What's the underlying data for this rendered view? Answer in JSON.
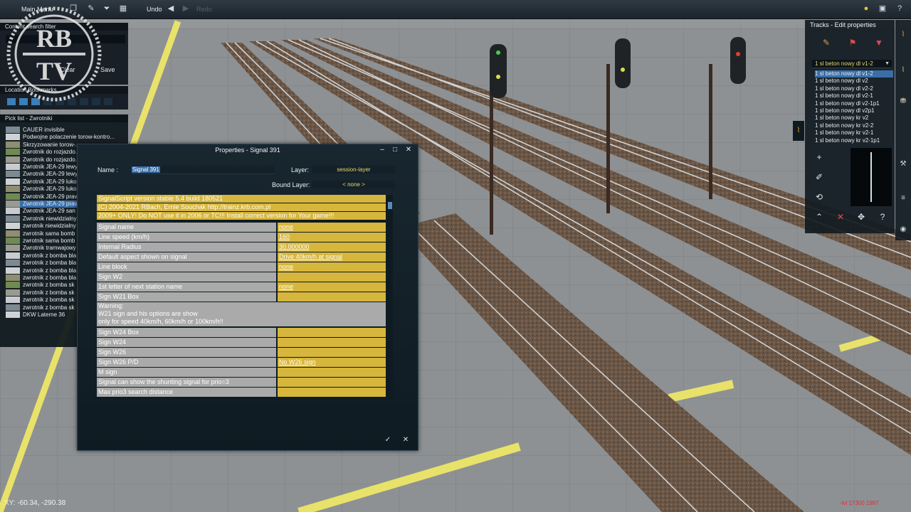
{
  "toolbar": {
    "main_menu": "Main Menu",
    "undo": "Undo",
    "redo": "Redo"
  },
  "left_panels": {
    "content_search_filter": "Content search filter",
    "clear": "Clear",
    "save": "Save",
    "location_bookmarks": "Location Bookmarks",
    "pick_list_title": "Pick list - Zwrotniki",
    "pick_items": [
      "CAUER invisible",
      "Podwojne polaczenie torow-kontro...",
      "Skrzyzowanie torow-...",
      "Zwrotnik do rozjazdo...",
      "Zwrotnik do rozjazdo...",
      "Zwrotnik JEA-29 lewy",
      "Zwrotnik JEA-29 lewy",
      "Zwrotnik JEA-29 luko",
      "Zwrotnik JEA-29 luko",
      "Zwrotnik JEA-29 prav",
      "Zwrotnik JEA-29 prav",
      "Zwrotnik JEA-29 san",
      "Zwrotnik niewidzialny",
      "zwrotnik niewidzialny",
      "zwrotnik sama bomb",
      "zwrotnik sama bomb",
      "Zwrotnik tramwajowy",
      "zwrotnik z bomba bla",
      "zwrotnik z bomba bla",
      "zwrotnik z bomba bla",
      "zwrotnik z bomba bla",
      "zwrotnik z bomba sk",
      "zwrotnik z bomba sk",
      "zwrotnik z bomba sk",
      "zwrotnik z bomba sk",
      "DKW Laterne 36"
    ],
    "selected_pick_index": 10
  },
  "logo": {
    "text_top": "RB",
    "text_bottom": "TV"
  },
  "dialog": {
    "title": "Properties - Signal 391",
    "name_label": "Name :",
    "name_value": "Signal 391",
    "layer_label": "Layer:",
    "layer_value": "session-layer",
    "bound_layer_label": "Bound Layer:",
    "bound_layer_value": "< none >",
    "header_lines": [
      "SignalScript version  stable 5.4 build 180521",
      "(C) 2004-2021 RBach, Ernie Souchak http://trainz.krb.com.pl",
      "2009+ ONLY! Do NOT use it in 2006 or TC!!! Install correct version for Your game!!!"
    ],
    "rows_a": [
      {
        "k": "Signal name",
        "v": "none"
      },
      {
        "k": "Line speed (km/h)",
        "v": "160"
      },
      {
        "k": "Internal Radius",
        "v": "30.000000"
      },
      {
        "k": "Default aspect shown on signal",
        "v": "Drive 40km/h at signal"
      },
      {
        "k": "Line block",
        "v": "none"
      },
      {
        "k": "Sign W2",
        "v": ""
      },
      {
        "k": "1st letter of next station name",
        "v": "none"
      },
      {
        "k": "Sign W21 Box",
        "v": ""
      }
    ],
    "warning_lines": [
      "Warning:",
      "W21 sign and his options are show",
      "only for speed 40km/h, 60km/h or 100km/h!!"
    ],
    "rows_b": [
      {
        "k": "Sign W24 Box",
        "v": ""
      },
      {
        "k": "Sign W24",
        "v": ""
      },
      {
        "k": "Sign W26",
        "v": ""
      },
      {
        "k": "Sign W26 P/D",
        "v": "No W26 sign"
      },
      {
        "k": "M sign",
        "v": ""
      },
      {
        "k": "Signal can show the shunting signal for prio=3",
        "v": ""
      },
      {
        "k": "Max prio3 search distance",
        "v": ""
      }
    ],
    "ok_icon": "check-icon",
    "cancel_icon": "close-icon"
  },
  "right_panel": {
    "title": "Tracks - Edit properties",
    "selected_track": "1 sl beton nowy dl v1-2",
    "track_items": [
      "1 sl beton nowy dl v1-2",
      "1 sl beton nowy dl v2",
      "1 sl beton nowy dl v2-2",
      "1 sl beton nowy dl v2-1",
      "1 sl beton nowy dl v2-1p1",
      "1 sl beton nowy dl v2p1",
      "1 sl beton nowy kr v2",
      "1 sl beton nowy kr v2-2",
      "1 sl beton nowy kr v2-1",
      "1 sl beton nowy kr v2-1p1"
    ]
  },
  "status": {
    "coords": "XY: -60.34, -290.38",
    "build": "-lvl 17300 1997"
  },
  "colors": {
    "dialog_bg": "#142229",
    "prop_key_bg": "#a9aaa9",
    "prop_value_bg": "#d6b63c",
    "selection": "#3a6ea8",
    "accent_yellow": "#e9d86b"
  }
}
